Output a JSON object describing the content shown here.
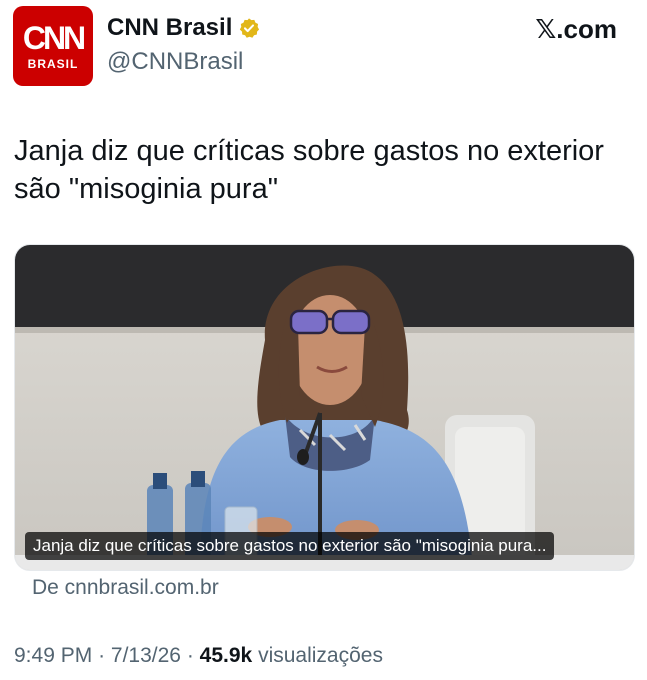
{
  "account": {
    "avatar_text": "CNN",
    "avatar_subtext": "BRASIL",
    "display_name": "CNN Brasil",
    "handle": "@CNNBrasil",
    "verified_icon": "verified-gold-badge-icon"
  },
  "platform": {
    "label": "𝕏.com"
  },
  "tweet": {
    "text": "Janja diz que críticas sobre gastos no exterior são \"misoginia pura\"",
    "time": "9:49 PM",
    "date": "7/13/26",
    "views_count": "45.9k",
    "views_label": "visualizações",
    "separator": "·"
  },
  "card": {
    "caption": "Janja diz que críticas sobre gastos no exterior são \"misoginia pura...",
    "source": "De cnnbrasil.com.br"
  },
  "colors": {
    "brand_red": "#cc0000",
    "verified_gold": "#e2b719",
    "text_primary": "#0f1419",
    "text_secondary": "#536471"
  }
}
